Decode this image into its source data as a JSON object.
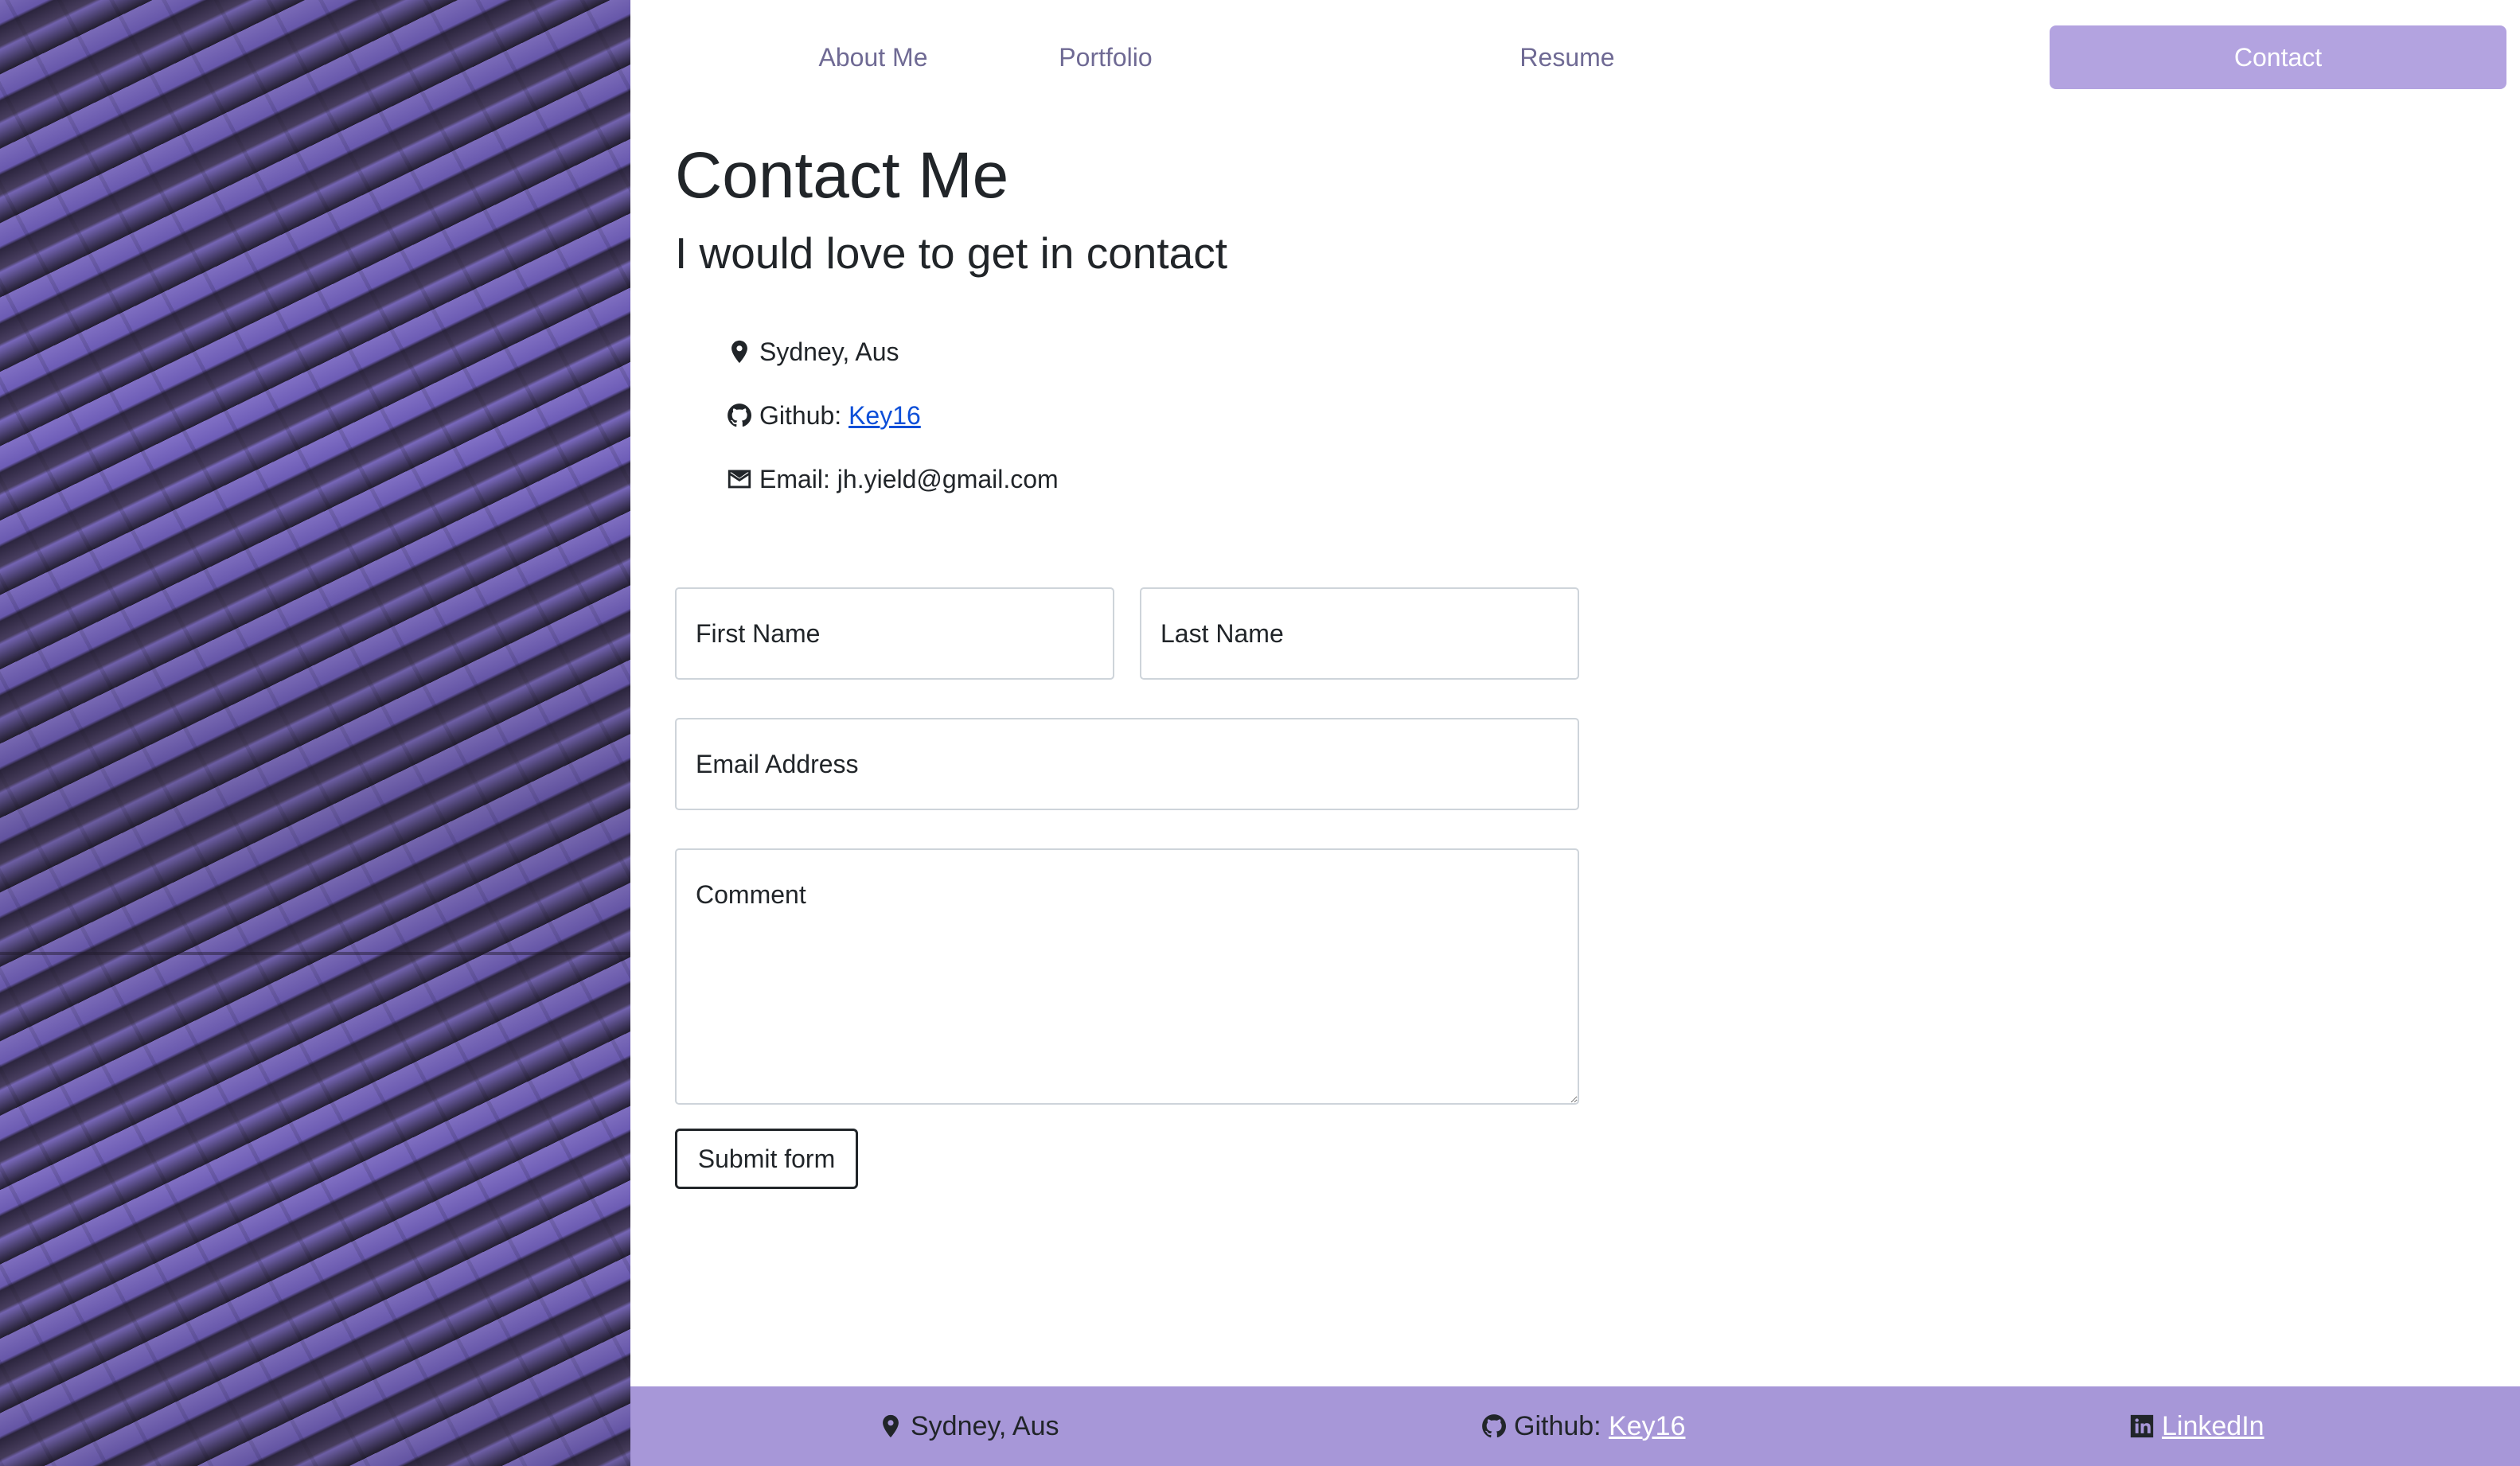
{
  "nav": {
    "items": [
      {
        "label": "About Me"
      },
      {
        "label": "Portfolio"
      },
      {
        "label": "Resume"
      },
      {
        "label": "Contact",
        "active": true
      }
    ]
  },
  "page": {
    "title": "Contact Me",
    "subtitle": "I would love to get in contact"
  },
  "contact": {
    "location": "Sydney, Aus",
    "github_prefix": "Github: ",
    "github_link": "Key16",
    "email_prefix": "Email: ",
    "email_value": "jh.yield@gmail.com"
  },
  "form": {
    "first_name_placeholder": "First Name",
    "last_name_placeholder": "Last Name",
    "email_placeholder": "Email Address",
    "comment_placeholder": "Comment",
    "submit_label": "Submit form"
  },
  "footer": {
    "location": "Sydney, Aus",
    "github_prefix": "Github: ",
    "github_link": "Key16",
    "linkedin_link": "LinkedIn"
  },
  "icons": {
    "location": "map-pin-icon",
    "github": "github-icon",
    "email": "envelope-icon",
    "linkedin": "linkedin-icon"
  },
  "colors": {
    "accent": "#b3a3e0",
    "footer_bg": "#a797d8",
    "nav_text": "#6f6a94",
    "link": "#0d4fd8"
  }
}
